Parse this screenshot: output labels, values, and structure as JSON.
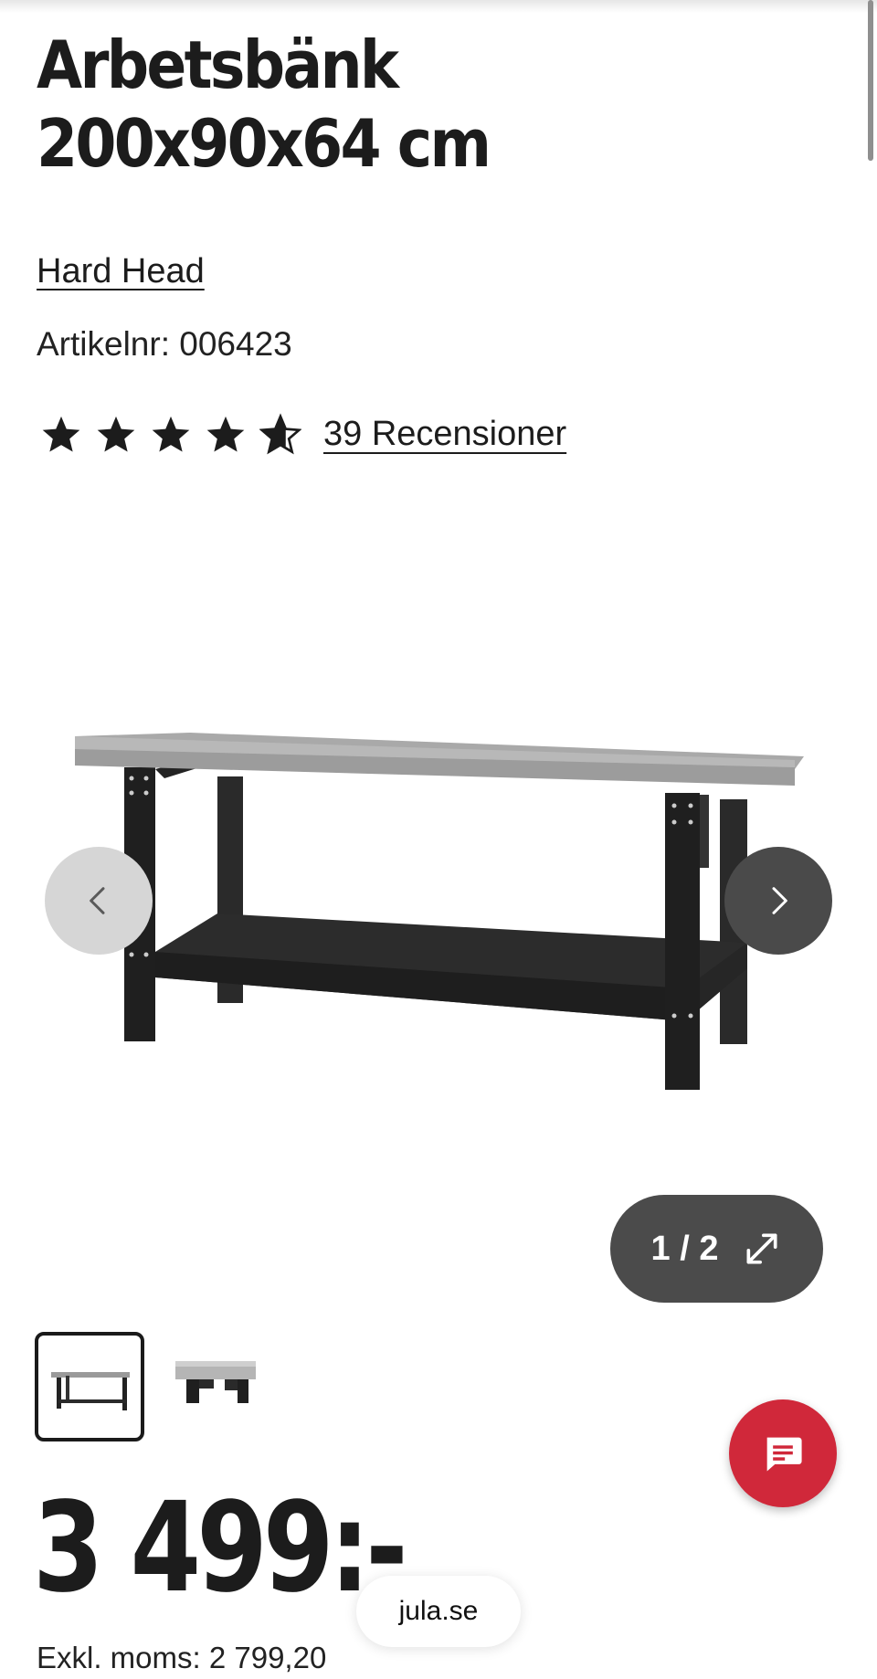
{
  "product": {
    "title": "Arbetsbänk 200x90x64 cm",
    "brand": "Hard Head",
    "article_label": "Artikelnr: 006423",
    "rating": {
      "value": 4.5,
      "max": 5,
      "reviews_label": "39 Recensioner"
    }
  },
  "gallery": {
    "counter": "1 / 2",
    "thumbnails": [
      "workbench-full",
      "workbench-detail"
    ]
  },
  "pricing": {
    "price": "3 499:-",
    "excl_vat": "Exkl. moms: 2 799,20"
  },
  "browser": {
    "url": "jula.se"
  },
  "colors": {
    "chat_button": "#d0283a",
    "counter_bg": "#4b4b4b"
  },
  "icons": {
    "prev": "chevron-left-icon",
    "next": "chevron-right-icon",
    "expand": "expand-icon",
    "chat": "chat-icon"
  }
}
